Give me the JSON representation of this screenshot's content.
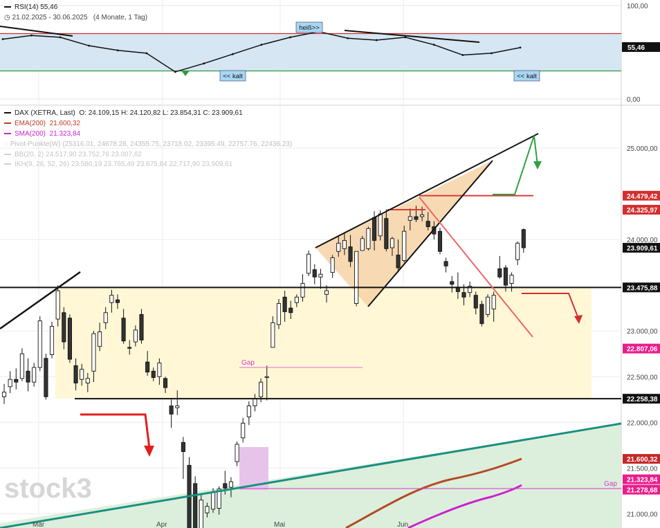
{
  "rsi_panel": {
    "legend_label": "RSI(14)",
    "legend_value": "55,46",
    "date_range": "21.02.2025 - 30.06.2025",
    "period_note": "(4 Monate, 1 Tag)",
    "hot_label": "heiß>>",
    "cold_label_1": "<< kalt",
    "cold_label_2": "<< kalt",
    "current_value_tag": "55,46"
  },
  "price_panel": {
    "dax_label": "DAX (XETRA, Last)",
    "dax_ohlc": "O: 24.109,15  H: 24.120,82  L: 23.854,31  C: 23.909,61",
    "ema_label": "EMA(200)",
    "ema_value": "21.600,32",
    "sma_label": "SMA(200)",
    "sma_value": "21.323,84",
    "pivot_label": "Pivot-Punkte(W)",
    "pivot_values": "(25316.01, 24678.28, 24355.75, 23718.02, 23395.49, 22757.76, 22436.23)",
    "bb_label": "BB(20, 2)",
    "bb_values": "24.517,90  23.752,76  23.007,62",
    "ikh_label": "IKH(9, 26, 52, 26)",
    "ikh_values": "23.580,19  23.765,49  23.675,84  22.717,90  23.909,61",
    "gap_label_1": "Gap",
    "gap_label_2": "Gap",
    "watermark": "stock3"
  },
  "price_tags": [
    {
      "text": "24.479,42",
      "color": "#d32f2f"
    },
    {
      "text": "24.325,97",
      "color": "#d32f2f"
    },
    {
      "text": "23.909,61",
      "color": "#111111"
    },
    {
      "text": "23.475,88",
      "color": "#111111"
    },
    {
      "text": "22.807,06",
      "color": "#e91e8c"
    },
    {
      "text": "22.258,38",
      "color": "#111111"
    },
    {
      "text": "21.600,32",
      "color": "#c62828"
    },
    {
      "text": "21.323,84",
      "color": "#e91e8c"
    },
    {
      "text": "21.278,68",
      "color": "#e91e8c"
    }
  ],
  "colors": {
    "rsi_band": "#d6e6f2",
    "rsi_upper": "#d32f2f",
    "rsi_lower": "#2e9b3e",
    "ema": "#b34a24",
    "sma": "#cc22cc",
    "trend": "#1a9080",
    "zone_yellow": "#fff7d6",
    "zone_green": "#d6ecd6",
    "wedge": "#f6d3a6",
    "gap_box": "#e6c4ea",
    "up_candle": "#ffffff",
    "down_candle": "#333333"
  },
  "chart_data": [
    {
      "type": "line",
      "title": "RSI(14)",
      "ylim": [
        0,
        100
      ],
      "ytick_labels": [
        "100,00",
        "0,00"
      ],
      "levels": [
        70,
        30
      ],
      "last_value": 55.46,
      "x": [
        "21.02.2025",
        "03.03.2025",
        "10.03.2025",
        "17.03.2025",
        "24.03.2025",
        "31.03.2025",
        "07.04.2025",
        "14.04.2025",
        "22.04.2025",
        "28.04.2025",
        "05.05.2025",
        "12.05.2025",
        "19.05.2025",
        "26.05.2025",
        "02.06.2025",
        "09.06.2025",
        "16.06.2025",
        "23.06.2025",
        "30.06.2025"
      ],
      "series": [
        {
          "values": [
            64,
            68,
            66,
            57,
            52,
            49,
            29,
            38,
            48,
            58,
            66,
            72,
            65,
            63,
            66,
            58,
            47,
            49,
            55
          ]
        }
      ]
    },
    {
      "type": "candlestick",
      "title": "DAX (XETRA, Last)",
      "xlabels": [
        "Mär",
        "Apr",
        "Mai",
        "Jun"
      ],
      "ytick_labels": [
        "25.000,00",
        "24.000,00",
        "23.000,00",
        "22.500,00",
        "22.000,00",
        "21.500,00",
        "21.000,00"
      ],
      "ylim": [
        20850,
        25650
      ],
      "candles": [
        {
          "o": 22280,
          "h": 22420,
          "l": 22200,
          "c": 22330
        },
        {
          "o": 22390,
          "h": 22560,
          "l": 22320,
          "c": 22470
        },
        {
          "o": 22470,
          "h": 22590,
          "l": 22360,
          "c": 22440
        },
        {
          "o": 22480,
          "h": 22810,
          "l": 22450,
          "c": 22750
        },
        {
          "o": 22560,
          "h": 22700,
          "l": 22340,
          "c": 22440
        },
        {
          "o": 22440,
          "h": 22650,
          "l": 22390,
          "c": 22600
        },
        {
          "o": 22600,
          "h": 23160,
          "l": 22560,
          "c": 23110
        },
        {
          "o": 22700,
          "h": 22750,
          "l": 22250,
          "c": 22280
        },
        {
          "o": 22740,
          "h": 23100,
          "l": 22700,
          "c": 23050
        },
        {
          "o": 23130,
          "h": 23500,
          "l": 23050,
          "c": 23440
        },
        {
          "o": 23200,
          "h": 23260,
          "l": 22800,
          "c": 22880
        },
        {
          "o": 23140,
          "h": 23180,
          "l": 22650,
          "c": 22690
        },
        {
          "o": 22620,
          "h": 22700,
          "l": 22350,
          "c": 22430
        },
        {
          "o": 22470,
          "h": 22640,
          "l": 22400,
          "c": 22580
        },
        {
          "o": 22430,
          "h": 22540,
          "l": 22330,
          "c": 22480
        },
        {
          "o": 22560,
          "h": 23000,
          "l": 22440,
          "c": 22970
        },
        {
          "o": 22830,
          "h": 23090,
          "l": 22780,
          "c": 22990
        },
        {
          "o": 23090,
          "h": 23260,
          "l": 23020,
          "c": 23200
        },
        {
          "o": 23310,
          "h": 23450,
          "l": 23200,
          "c": 23390
        },
        {
          "o": 23340,
          "h": 23400,
          "l": 23240,
          "c": 23310
        },
        {
          "o": 23140,
          "h": 23240,
          "l": 22860,
          "c": 22890
        },
        {
          "o": 22820,
          "h": 22900,
          "l": 22740,
          "c": 22810
        },
        {
          "o": 22880,
          "h": 23060,
          "l": 22830,
          "c": 23010
        },
        {
          "o": 23180,
          "h": 23240,
          "l": 22860,
          "c": 22900
        },
        {
          "o": 22660,
          "h": 22780,
          "l": 22510,
          "c": 22550
        },
        {
          "o": 22560,
          "h": 22600,
          "l": 22450,
          "c": 22490
        },
        {
          "o": 22500,
          "h": 22700,
          "l": 22410,
          "c": 22650
        },
        {
          "o": 22480,
          "h": 22500,
          "l": 22320,
          "c": 22380
        },
        {
          "o": 22180,
          "h": 22250,
          "l": 21940,
          "c": 22090
        },
        {
          "o": 22160,
          "h": 22350,
          "l": 22080,
          "c": 22180
        },
        {
          "o": 21780,
          "h": 21840,
          "l": 21380,
          "c": 21680
        },
        {
          "o": 21530,
          "h": 21620,
          "l": 20700,
          "c": 20820
        },
        {
          "o": 21330,
          "h": 21410,
          "l": 20600,
          "c": 20720
        },
        {
          "o": 20760,
          "h": 21210,
          "l": 20730,
          "c": 21150
        },
        {
          "o": 21010,
          "h": 21120,
          "l": 20960,
          "c": 21080
        },
        {
          "o": 21050,
          "h": 21280,
          "l": 21010,
          "c": 21240
        },
        {
          "o": 21060,
          "h": 21300,
          "l": 20990,
          "c": 21270
        },
        {
          "o": 21330,
          "h": 21470,
          "l": 21210,
          "c": 21280
        },
        {
          "o": 21290,
          "h": 21400,
          "l": 21180,
          "c": 21350
        },
        {
          "o": 21570,
          "h": 21790,
          "l": 21520,
          "c": 21760
        },
        {
          "o": 21830,
          "h": 22050,
          "l": 21780,
          "c": 21990
        },
        {
          "o": 22060,
          "h": 22230,
          "l": 21970,
          "c": 22180
        },
        {
          "o": 22180,
          "h": 22310,
          "l": 22120,
          "c": 22260
        },
        {
          "o": 22280,
          "h": 22480,
          "l": 22220,
          "c": 22440
        },
        {
          "o": 22490,
          "h": 22620,
          "l": 22240,
          "c": 22500
        },
        {
          "o": 22820,
          "h": 23160,
          "l": 22820,
          "c": 23090
        },
        {
          "o": 23070,
          "h": 23350,
          "l": 23020,
          "c": 23300
        },
        {
          "o": 23370,
          "h": 23440,
          "l": 23100,
          "c": 23210
        },
        {
          "o": 23250,
          "h": 23330,
          "l": 23130,
          "c": 23200
        },
        {
          "o": 23310,
          "h": 23400,
          "l": 23260,
          "c": 23370
        },
        {
          "o": 23370,
          "h": 23620,
          "l": 23320,
          "c": 23520
        },
        {
          "o": 23630,
          "h": 23880,
          "l": 23600,
          "c": 23840
        },
        {
          "o": 23670,
          "h": 23730,
          "l": 23510,
          "c": 23590
        },
        {
          "o": 23590,
          "h": 23680,
          "l": 23460,
          "c": 23620
        },
        {
          "o": 23400,
          "h": 23500,
          "l": 23310,
          "c": 23440
        },
        {
          "o": 23640,
          "h": 23830,
          "l": 23580,
          "c": 23800
        },
        {
          "o": 23870,
          "h": 24040,
          "l": 23810,
          "c": 23960
        },
        {
          "o": 23900,
          "h": 24070,
          "l": 23830,
          "c": 23990
        },
        {
          "o": 23920,
          "h": 24050,
          "l": 23700,
          "c": 23760
        },
        {
          "o": 23300,
          "h": 23580,
          "l": 23270,
          "c": 23870
        },
        {
          "o": 23880,
          "h": 24040,
          "l": 23880,
          "c": 24010
        },
        {
          "o": 23900,
          "h": 24140,
          "l": 23880,
          "c": 24120
        },
        {
          "o": 24240,
          "h": 24310,
          "l": 23880,
          "c": 23990
        },
        {
          "o": 24040,
          "h": 24320,
          "l": 23990,
          "c": 24280
        },
        {
          "o": 24230,
          "h": 24330,
          "l": 23870,
          "c": 23900
        },
        {
          "o": 23910,
          "h": 24030,
          "l": 23820,
          "c": 24010
        },
        {
          "o": 23830,
          "h": 24000,
          "l": 23640,
          "c": 23690
        },
        {
          "o": 23770,
          "h": 24150,
          "l": 23750,
          "c": 24090
        },
        {
          "o": 24210,
          "h": 24340,
          "l": 24100,
          "c": 24250
        },
        {
          "o": 24250,
          "h": 24370,
          "l": 24190,
          "c": 24220
        },
        {
          "o": 24250,
          "h": 24360,
          "l": 24200,
          "c": 24270
        },
        {
          "o": 24200,
          "h": 24300,
          "l": 24100,
          "c": 24140
        },
        {
          "o": 24140,
          "h": 24200,
          "l": 24000,
          "c": 24060
        },
        {
          "o": 24090,
          "h": 24130,
          "l": 23840,
          "c": 23870
        },
        {
          "o": 23760,
          "h": 23800,
          "l": 23640,
          "c": 23710
        },
        {
          "o": 23540,
          "h": 23600,
          "l": 23420,
          "c": 23510
        },
        {
          "o": 23480,
          "h": 23640,
          "l": 23350,
          "c": 23430
        },
        {
          "o": 23420,
          "h": 23510,
          "l": 23280,
          "c": 23370
        },
        {
          "o": 23420,
          "h": 23540,
          "l": 23370,
          "c": 23490
        },
        {
          "o": 23390,
          "h": 23430,
          "l": 23180,
          "c": 23250
        },
        {
          "o": 23290,
          "h": 23330,
          "l": 23050,
          "c": 23080
        },
        {
          "o": 23180,
          "h": 23400,
          "l": 23150,
          "c": 23370
        },
        {
          "o": 23240,
          "h": 23430,
          "l": 23100,
          "c": 23390
        },
        {
          "o": 23680,
          "h": 23820,
          "l": 23570,
          "c": 23590
        },
        {
          "o": 23690,
          "h": 23720,
          "l": 23430,
          "c": 23500
        },
        {
          "o": 23520,
          "h": 23640,
          "l": 23430,
          "c": 23610
        },
        {
          "o": 23780,
          "h": 23980,
          "l": 23720,
          "c": 23960
        },
        {
          "o": 24109.15,
          "h": 24120.82,
          "l": 23854.31,
          "c": 23909.61
        }
      ],
      "series": [
        {
          "name": "EMA(200)",
          "last": 21600.32
        },
        {
          "name": "SMA(200)",
          "last": 21323.84
        }
      ],
      "levels": [
        {
          "value": 24479.42
        },
        {
          "value": 24325.97
        },
        {
          "value": 23475.88
        },
        {
          "value": 22807.06
        },
        {
          "value": 22258.38
        },
        {
          "value": 21278.68
        }
      ],
      "annotations": [
        "Gap",
        "Gap"
      ]
    }
  ]
}
